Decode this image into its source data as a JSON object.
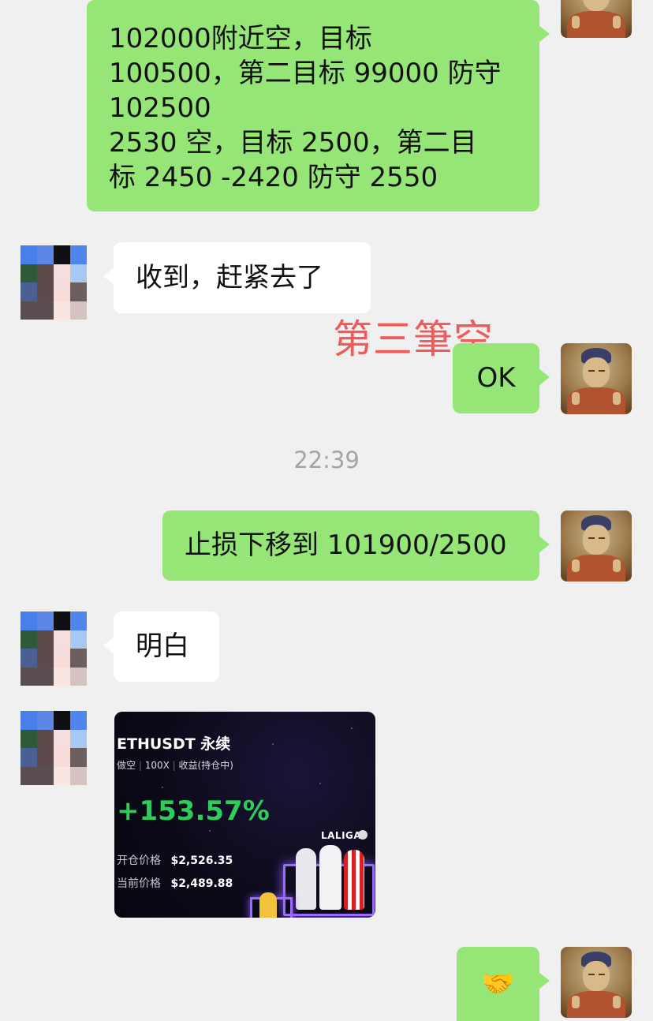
{
  "messages": {
    "m1_lines": [
      "102000附近空，目标",
      "100500，第二目标 99000 防守",
      "102500",
      "2530 空，目标 2500，第二目",
      "标 2450 -2420 防守 2550"
    ],
    "m2": "收到，赶紧去了",
    "m3": "OK",
    "timestamp": "22:39",
    "m4": "止损下移到 101900/2500",
    "m5": "明白",
    "m6_emoji": "🤝"
  },
  "overlay_caption": "第三筆空",
  "trade_card": {
    "symbol": "ETHUSDT 永续",
    "side": "做空",
    "leverage": "100X",
    "pnl_label": "收益(持仓中)",
    "pnl": "+153.57%",
    "brand": "LALIGA",
    "entry_label": "开仓价格",
    "entry_price": "$2,526.35",
    "current_label": "当前价格",
    "current_price": "$2,489.88"
  },
  "colors": {
    "my_bubble": "#95e677",
    "their_bubble": "#ffffff",
    "background": "#f0f0f0",
    "pnl_green": "#2ecc5a",
    "overlay_red": "#ef5a5a"
  },
  "icons": {
    "my_avatar": "buddha-painting-avatar",
    "their_avatar": "pixelated-avatar",
    "handshake": "handshake-emoji"
  }
}
